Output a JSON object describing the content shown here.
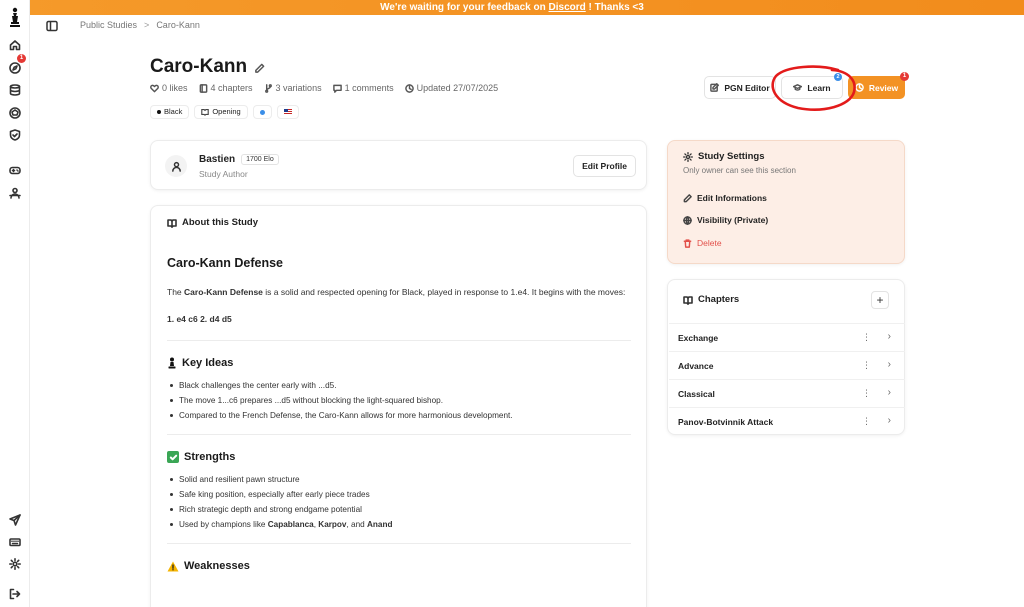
{
  "banner": {
    "text_before": "We're waiting for your feedback on ",
    "link": "Discord",
    "text_after": " ! Thanks <3"
  },
  "rail": {
    "notification_count": "1",
    "icons": [
      "chess-logo-icon",
      "home-icon",
      "compass-icon",
      "database-icon",
      "puzzle-icon",
      "shield-icon",
      "gamepad-icon",
      "users-icon",
      "send-icon",
      "keyboard-icon",
      "settings-icon",
      "logout-icon"
    ]
  },
  "breadcrumb": {
    "parent": "Public Studies",
    "separator": ">",
    "current": "Caro-Kann"
  },
  "study": {
    "title": "Caro-Kann",
    "meta": {
      "likes": "0 likes",
      "chapters": "4 chapters",
      "variations": "3 variations",
      "comments": "1 comments",
      "updated": "Updated 27/07/2025"
    },
    "tags": [
      "Black",
      "Opening"
    ]
  },
  "actions": {
    "pgn_editor": "PGN Editor",
    "learn": "Learn",
    "learn_badge": "2",
    "review": "Review",
    "review_badge": "1"
  },
  "author": {
    "name": "Bastien",
    "elo": "1700 Elo",
    "role": "Study Author",
    "edit_label": "Edit Profile"
  },
  "about": {
    "heading": "About this Study",
    "title": "Caro-Kann Defense",
    "intro_pre": "The ",
    "intro_bold": "Caro-Kann Defense",
    "intro_post": " is a solid and respected opening for Black, played in response to 1.e4. It begins with the moves:",
    "moves": "1. e4 c6 2. d4 d5",
    "key_ideas_title": "Key Ideas",
    "key_ideas": [
      "Black challenges the center early with ...d5.",
      "The move 1...c6 prepares ...d5 without blocking the light-squared bishop.",
      "Compared to the French Defense, the Caro-Kann allows for more harmonious development."
    ],
    "strengths_title": "Strengths",
    "strengths": [
      "Solid and resilient pawn structure",
      "Safe king position, especially after early piece trades",
      "Rich strategic depth and strong endgame potential"
    ],
    "champions_pre": "Used by champions like ",
    "champion_1": "Capablanca",
    "champions_sep1": ", ",
    "champion_2": "Karpov",
    "champions_sep2": ", and ",
    "champion_3": "Anand",
    "weaknesses_title": "Weaknesses"
  },
  "settings": {
    "title": "Study Settings",
    "subtitle": "Only owner can see this section",
    "edit": "Edit Informations",
    "visibility": "Visibility (Private)",
    "delete": "Delete"
  },
  "chapters": {
    "title": "Chapters",
    "add_label": "+",
    "items": [
      "Exchange",
      "Advance",
      "Classical",
      "Panov-Botvinnik Attack"
    ]
  },
  "colors": {
    "accent": "#f39224",
    "settings_bg": "#fdeee6",
    "danger": "#e2504a",
    "annotation": "#e31b1b"
  }
}
